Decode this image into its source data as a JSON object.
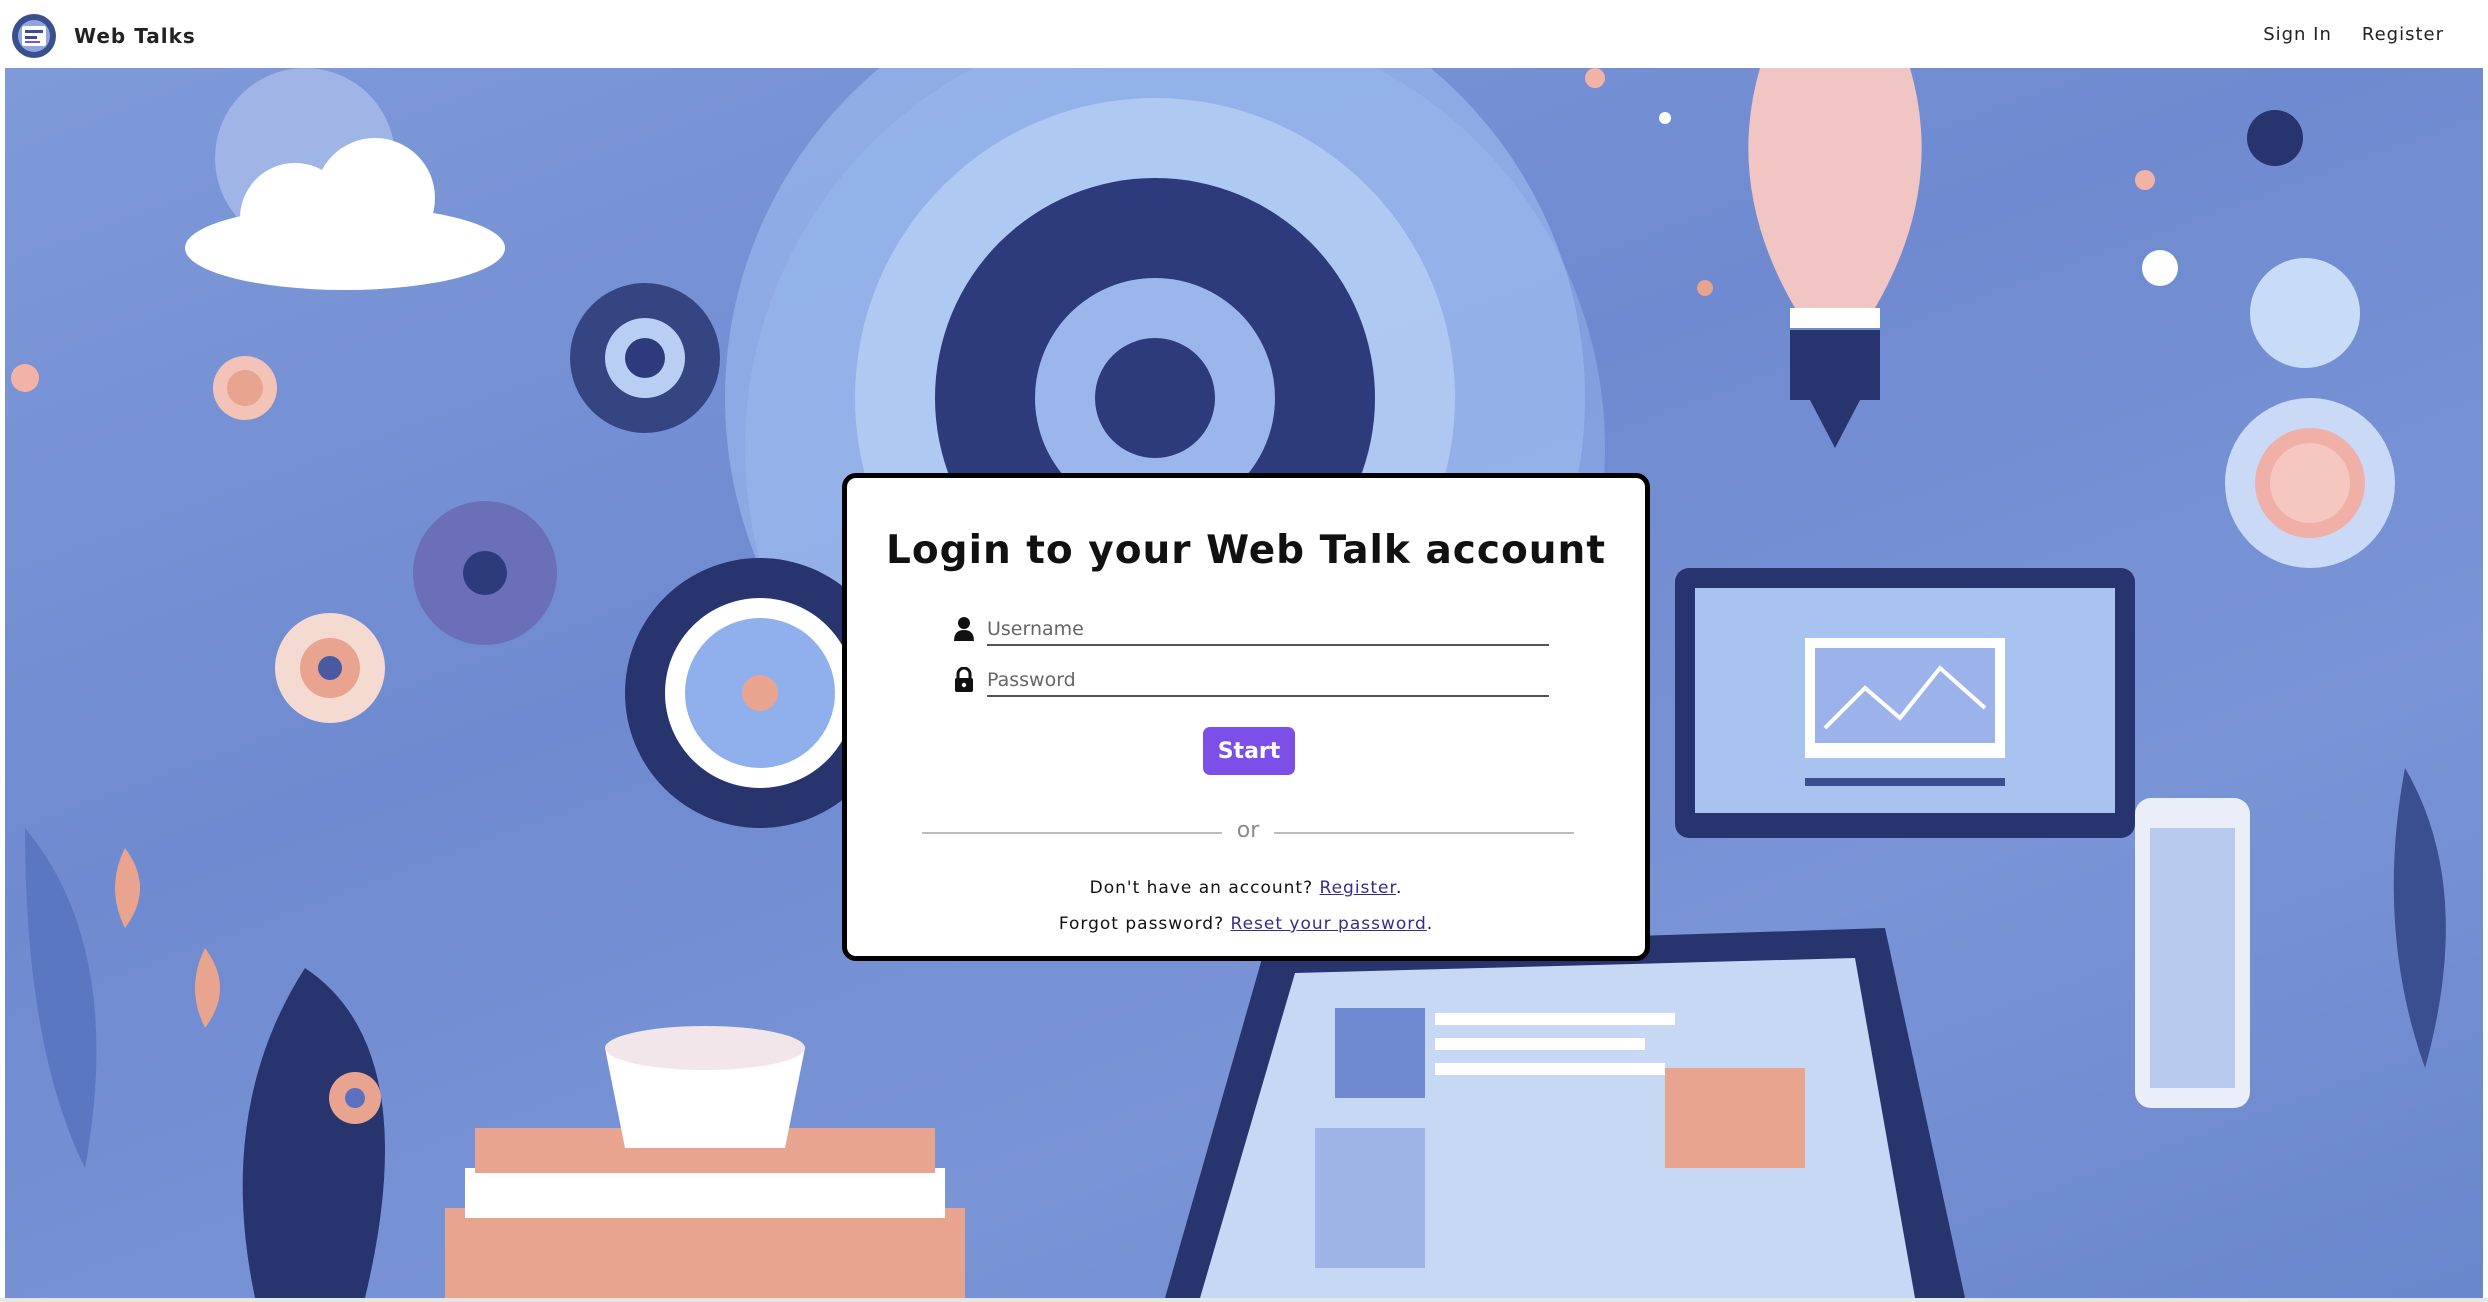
{
  "navbar": {
    "brand_name": "Web Talks",
    "sign_in_label": "Sign In",
    "register_label": "Register"
  },
  "login": {
    "title": "Login to your Web Talk account",
    "username_placeholder": "Username",
    "password_placeholder": "Password",
    "start_label": "Start",
    "or_label": "or",
    "no_account_text": "Don't have an account?",
    "register_link": "Register",
    "forgot_text": "Forgot password?",
    "reset_link": "Reset your password",
    "period": "."
  },
  "icons": {
    "logo": "web-talks-logo",
    "username": "user-icon",
    "password": "lock-icon"
  },
  "colors": {
    "accent": "#7b4fe8",
    "link": "#3b2a8a",
    "hero_background": "#7f9ad9"
  }
}
